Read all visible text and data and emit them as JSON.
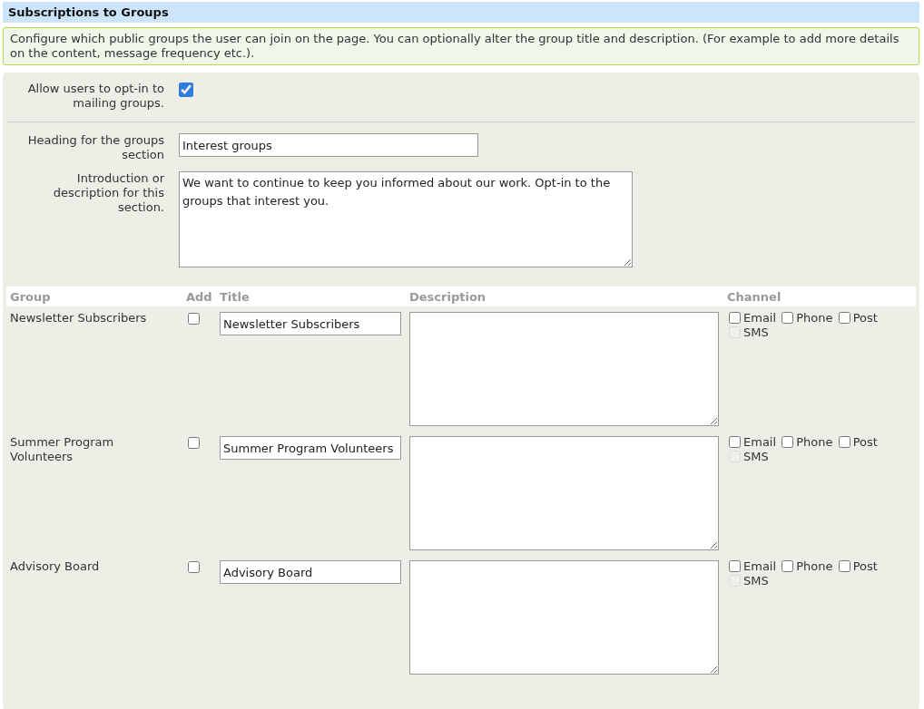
{
  "section_title": "Subscriptions to Groups",
  "info": "Configure which public groups the user can join on the page. You can optionally alter the group title and description. (For example to add more details on the content, message frequency etc.).",
  "opt_in": {
    "label": "Allow users to opt-in to mailing groups.",
    "checked": true
  },
  "heading_field": {
    "label": "Heading for the groups section",
    "value": "Interest groups"
  },
  "intro_field": {
    "label": "Introduction or description for this section.",
    "value": "We want to continue to keep you informed about our work. Opt-in to the groups that interest you."
  },
  "table": {
    "columns": [
      "Group",
      "Add",
      "Title",
      "Description",
      "Channel"
    ],
    "rows": [
      {
        "group": "Newsletter Subscribers",
        "add": false,
        "title": "Newsletter Subscribers",
        "channels": [
          {
            "label": "Email",
            "checked": false,
            "disabled": false
          },
          {
            "label": "Phone",
            "checked": false,
            "disabled": false
          },
          {
            "label": "Post",
            "checked": false,
            "disabled": false
          },
          {
            "label": "SMS",
            "checked": false,
            "disabled": true
          }
        ]
      },
      {
        "group": "Summer Program Volunteers",
        "add": false,
        "title": "Summer Program Volunteers",
        "channels": [
          {
            "label": "Email",
            "checked": false,
            "disabled": false
          },
          {
            "label": "Phone",
            "checked": false,
            "disabled": false
          },
          {
            "label": "Post",
            "checked": false,
            "disabled": false
          },
          {
            "label": "SMS",
            "checked": false,
            "disabled": true
          }
        ]
      },
      {
        "group": "Advisory Board",
        "add": false,
        "title": "Advisory Board",
        "channels": [
          {
            "label": "Email",
            "checked": false,
            "disabled": false
          },
          {
            "label": "Phone",
            "checked": false,
            "disabled": false
          },
          {
            "label": "Post",
            "checked": false,
            "disabled": false
          },
          {
            "label": "SMS",
            "checked": false,
            "disabled": true
          }
        ]
      }
    ]
  }
}
